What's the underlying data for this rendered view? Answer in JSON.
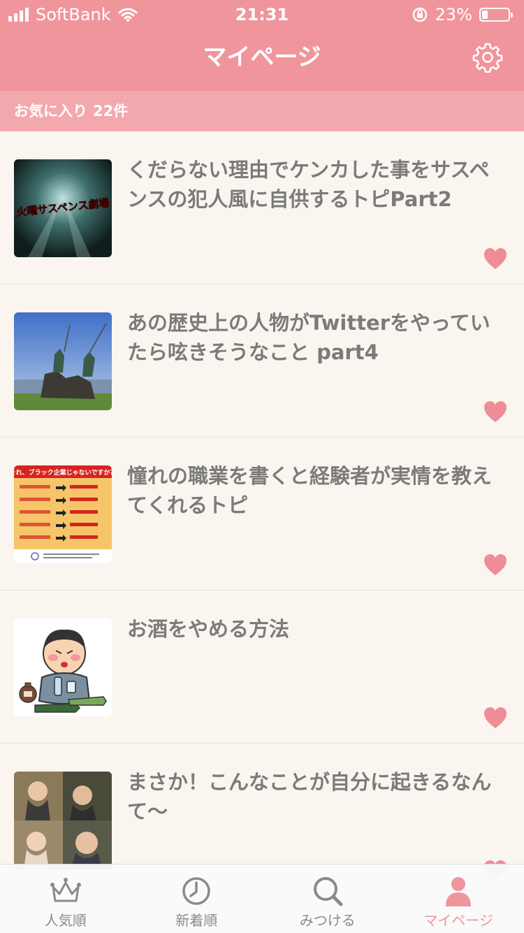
{
  "status_bar": {
    "carrier": "SoftBank",
    "time": "21:31",
    "battery": "23%",
    "battery_level": 0.23
  },
  "header": {
    "title": "マイページ"
  },
  "section": {
    "label": "お気に入り",
    "count": "22件"
  },
  "items": [
    {
      "title": "くだらない理由でケンカした事をサスペンスの犯人風に自供するトピPart2",
      "thumb_text": "火曜サスペンス劇場"
    },
    {
      "title": "あの歴史上の人物がTwitterをやっていたら呟きそうなこと part4"
    },
    {
      "title": "憧れの職業を書くと経験者が実情を教えてくれるトピ",
      "thumb_text": "それ、ブラック企業じゃないですか？"
    },
    {
      "title": "お酒をやめる方法"
    },
    {
      "title": "まさか！こんなことが自分に起きるなんて〜"
    }
  ],
  "tabs": [
    {
      "label": "人気順"
    },
    {
      "label": "新着順"
    },
    {
      "label": "みつける"
    },
    {
      "label": "マイページ"
    }
  ],
  "colors": {
    "accent": "#f0959c",
    "background": "#faf6ef",
    "text": "#7b7b7b",
    "heart": "#ef8d96"
  }
}
